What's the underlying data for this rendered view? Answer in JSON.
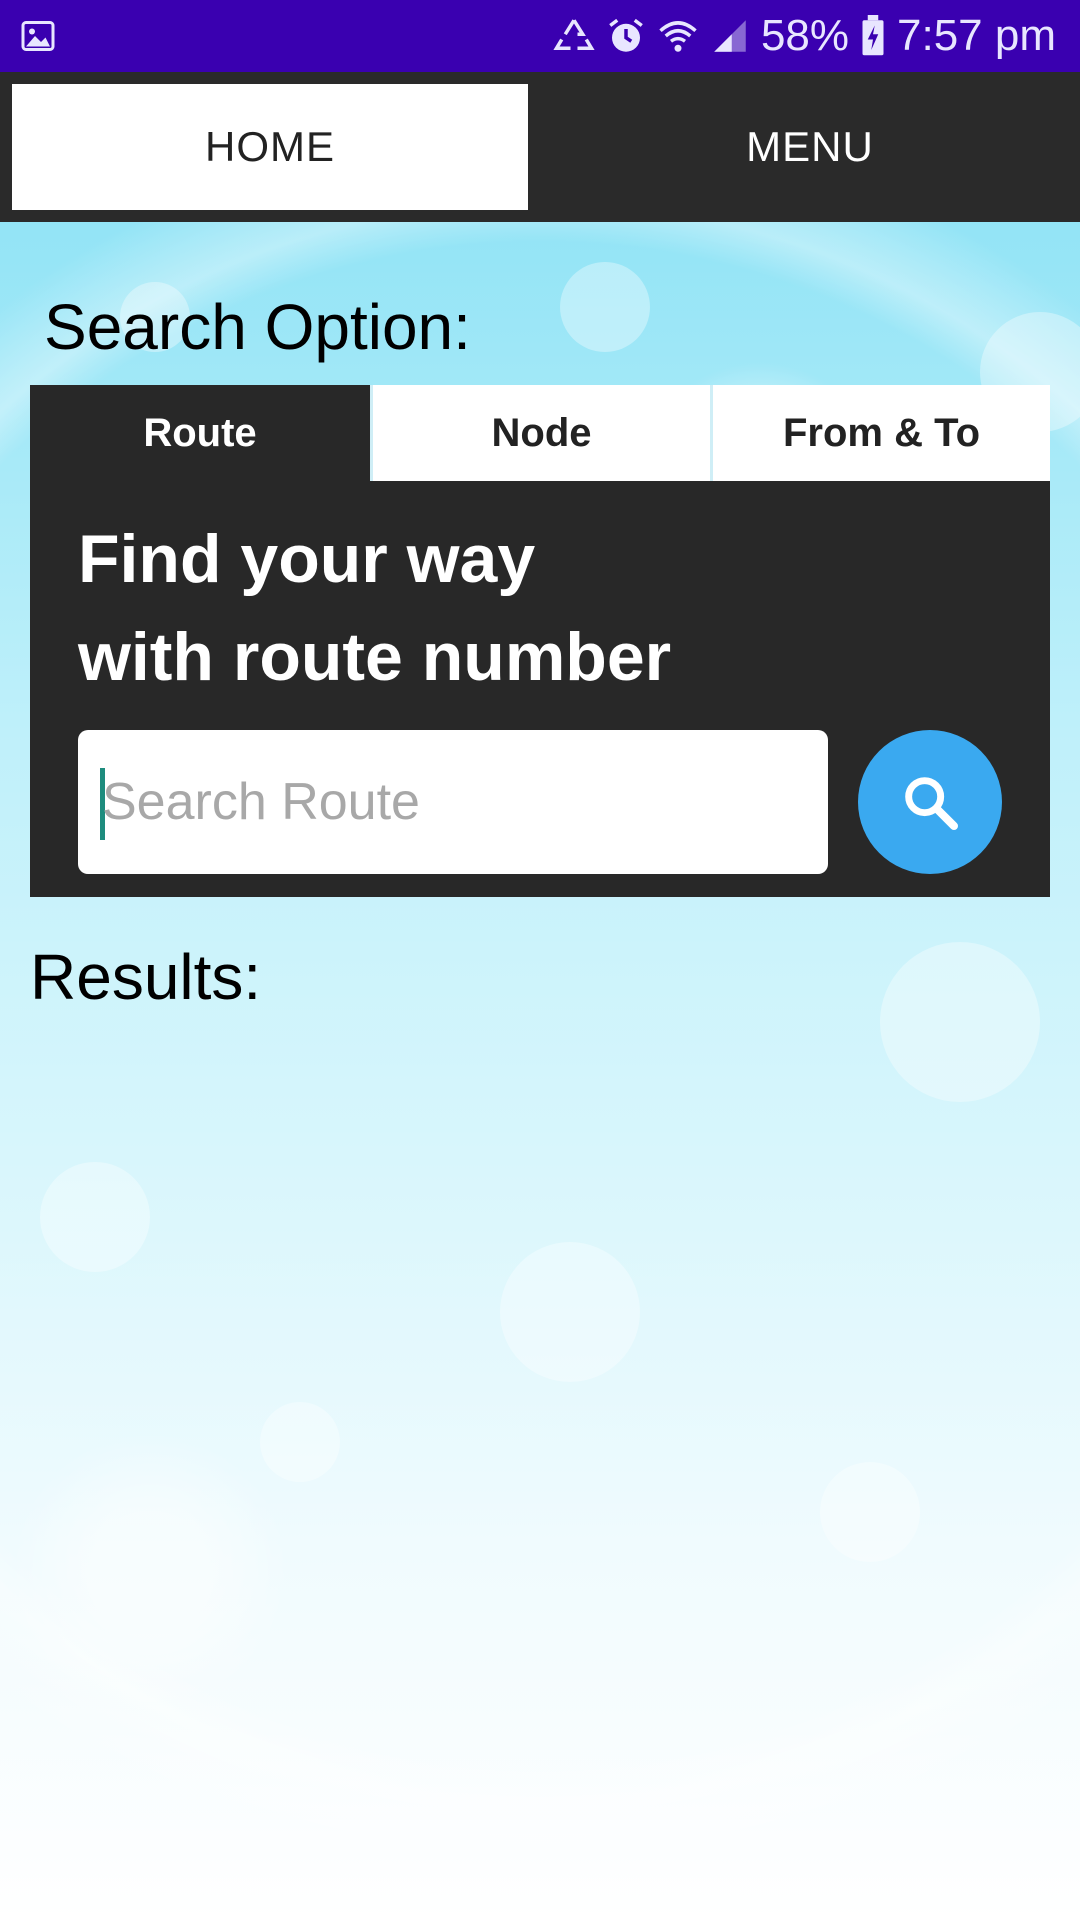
{
  "status_bar": {
    "battery": "58%",
    "time": "7:57 pm",
    "icons": [
      "gallery-icon",
      "recycle-icon",
      "alarm-icon",
      "wifi-icon",
      "signal-icon",
      "battery-charging-icon"
    ]
  },
  "top_nav": {
    "tabs": [
      {
        "label": "HOME",
        "active": true
      },
      {
        "label": "MENU",
        "active": false
      }
    ]
  },
  "search_option": {
    "title": "Search Option:"
  },
  "search_panel": {
    "tabs": [
      {
        "label": "Route",
        "active": true
      },
      {
        "label": "Node",
        "active": false
      },
      {
        "label": "From & To",
        "active": false
      }
    ],
    "headline_line1": "Find your way",
    "headline_line2": "with route number",
    "input_value": "",
    "input_placeholder": "Search Route",
    "search_icon": "search-icon"
  },
  "results": {
    "title": "Results:"
  },
  "colors": {
    "status_bar": "#3a00b0",
    "nav_bg": "#2a2a2a",
    "panel_bg": "#282828",
    "accent_button": "#3aa9f0",
    "caret": "#1e8c7e"
  }
}
